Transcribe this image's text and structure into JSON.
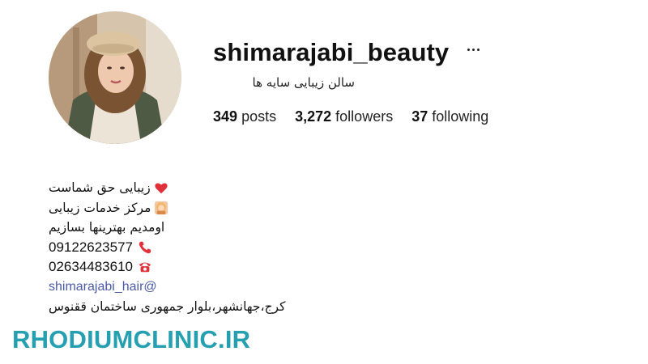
{
  "profile": {
    "username": "shimarajabi_beauty",
    "full_name": "سالن زیبایی سایه ها",
    "more_icon": "ellipsis-icon",
    "avatar": "profile-photo"
  },
  "stats": {
    "posts_count": "349",
    "posts_label": "posts",
    "followers_count": "3,272",
    "followers_label": "followers",
    "following_count": "37",
    "following_label": "following"
  },
  "bio": {
    "line1": "زیبایی حق شماست",
    "line1_icon": "red-heart-icon",
    "line2": "مرکز خدمات زیبایی",
    "line2_icon": "woman-haircut-icon",
    "line3": "اومدیم بهترینها بسازیم",
    "phone_mobile": "09122623577",
    "phone_mobile_icon": "phone-handset-icon",
    "phone_landline": "02634483610",
    "phone_landline_icon": "telephone-icon",
    "mention": "shimarajabi_hair@",
    "address": "کرج،جهانشهر،بلوار جمهوری ساختمان ققنوس"
  },
  "watermark": "RHODIUMCLINIC.IR",
  "colors": {
    "text": "#111111",
    "link": "#4a5aa8",
    "watermark": "#26a0b0",
    "heart": "#e0313a",
    "phone_icon": "#e0313a"
  }
}
